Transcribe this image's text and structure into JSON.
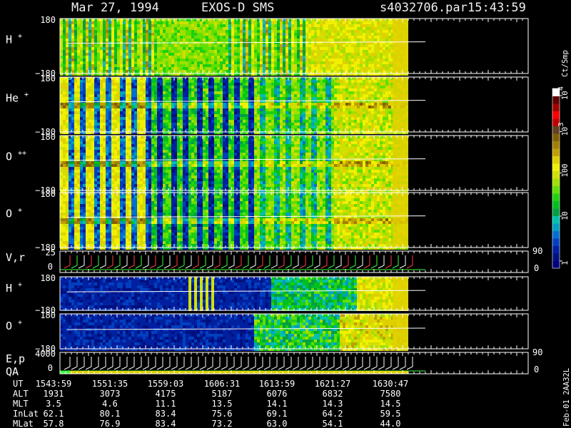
{
  "header": {
    "date": "Mar 27, 1994",
    "instrument": "EXOS-D SMS",
    "file": "s4032706.par",
    "time": "15:43:59"
  },
  "side_label": "Feb-01  2AA32L",
  "chart_data": {
    "type": "heatmap",
    "x_start_label": "1543:59",
    "x_end_label": "1630:47",
    "panels": [
      {
        "id": "p1",
        "label": "H",
        "superscript": "+",
        "ymax": "180",
        "ymin": "−180"
      },
      {
        "id": "p2",
        "label": "He",
        "superscript": "+",
        "ymax": "180",
        "ymin": "−180"
      },
      {
        "id": "p3",
        "label": "O",
        "superscript": "++",
        "ymax": "180",
        "ymin": "−180"
      },
      {
        "id": "p4",
        "label": "O",
        "superscript": "+",
        "ymax": "180",
        "ymin": "−180"
      },
      {
        "id": "p5",
        "label": "V,r",
        "superscript": "",
        "ymax": "25",
        "ymid": "0",
        "right_top": "90",
        "right_bottom": "0"
      },
      {
        "id": "p6",
        "label": "H",
        "superscript": "+",
        "ymax": "180",
        "ymin": "−180"
      },
      {
        "id": "p7",
        "label": "O",
        "superscript": "+",
        "ymax": "180",
        "ymin": "−180"
      },
      {
        "id": "p8",
        "label": "E,p",
        "label2": "QA",
        "ymax": "4000",
        "ymid": "0",
        "right_top": "90",
        "right_bottom": "0"
      }
    ],
    "colorbar": {
      "title": "Ct/Smp",
      "ticks": [
        {
          "base": "10",
          "exp": "4"
        },
        {
          "base": "10",
          "exp": "3"
        },
        {
          "base": "100",
          "exp": ""
        },
        {
          "base": "10",
          "exp": ""
        },
        {
          "base": "1",
          "exp": ""
        }
      ],
      "colors": [
        "#000080",
        "#00107f",
        "#0020a0",
        "#0040c0",
        "#0070d0",
        "#00a0c0",
        "#00c0b0",
        "#00a040",
        "#00c020",
        "#20d010",
        "#60e000",
        "#a0e000",
        "#d0e000",
        "#f0f000",
        "#e0d000",
        "#c0a000",
        "#a08000",
        "#806000",
        "#604020",
        "#c00000",
        "#ff0000",
        "#a00000",
        "#600000",
        "#ffffff"
      ]
    },
    "table": {
      "rows": [
        {
          "label": "UT",
          "values": [
            "1543:59",
            "1551:35",
            "1559:03",
            "1606:31",
            "1613:59",
            "1621:27",
            "1630:47"
          ]
        },
        {
          "label": "ALT",
          "values": [
            "1931",
            "3073",
            "4175",
            "5187",
            "6076",
            "6832",
            "7580"
          ]
        },
        {
          "label": "MLT",
          "values": [
            "3.5",
            "4.6",
            "11.1",
            "13.5",
            "14.1",
            "14.3",
            "14.5"
          ]
        },
        {
          "label": "InLat",
          "values": [
            "62.1",
            "80.1",
            "83.4",
            "75.6",
            "69.1",
            "64.2",
            "59.5"
          ]
        },
        {
          "label": "MLat",
          "values": [
            "57.8",
            "76.9",
            "83.4",
            "73.2",
            "63.0",
            "54.1",
            "44.0"
          ]
        }
      ]
    }
  }
}
